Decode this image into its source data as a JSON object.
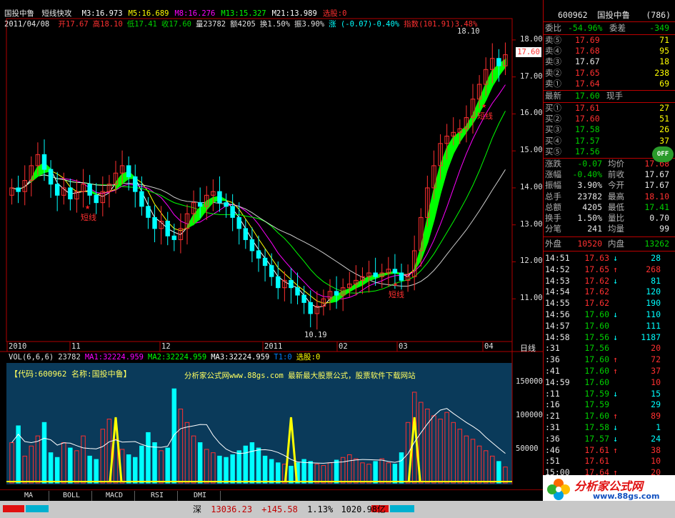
{
  "header": {
    "name": "国投中鲁",
    "indicator": "短线快攻",
    "ma_items": [
      {
        "label": "M3:16.973",
        "color": "#ffffff"
      },
      {
        "label": "M5:16.689",
        "color": "#ffff00"
      },
      {
        "label": "M8:16.276",
        "color": "#ff00ff"
      },
      {
        "label": "M13:15.327",
        "color": "#00ff00"
      },
      {
        "label": "M21:13.989",
        "color": "#ffffff"
      },
      {
        "label": "选股:0",
        "color": "#ff3030"
      }
    ],
    "date": "2011/04/08",
    "quote_items": [
      {
        "label": "开17.67",
        "color": "#ff3030"
      },
      {
        "label": "高18.10",
        "color": "#ff3030"
      },
      {
        "label": "低17.41",
        "color": "#00d000"
      },
      {
        "label": "收17.60",
        "color": "#00d000"
      },
      {
        "label": "量23782",
        "color": "#e0e0e0"
      },
      {
        "label": "额4205",
        "color": "#e0e0e0"
      },
      {
        "label": "换1.50%",
        "color": "#e0e0e0"
      },
      {
        "label": "振3.90%",
        "color": "#e0e0e0"
      },
      {
        "label": "涨 (-0.07)-0.40%",
        "color": "#00ffff"
      },
      {
        "label": "指数(101.91)3.48%",
        "color": "#ff3030"
      }
    ]
  },
  "price_axis": {
    "labels": [
      "18.00",
      "17.00",
      "16.00",
      "15.00",
      "14.00",
      "13.00",
      "12.00",
      "11.00"
    ],
    "current_price": "17.60",
    "high_label": "18.10",
    "low_label": "10.19"
  },
  "annotations": {
    "short_line": "短线"
  },
  "time_axis": {
    "labels": [
      "2010",
      "11",
      "12",
      "2011",
      "02",
      "03",
      "04"
    ],
    "period": "日线"
  },
  "volume": {
    "header_items": [
      {
        "label": "VOL(6,6,6)",
        "color": "#e0e0e0"
      },
      {
        "label": "23782",
        "color": "#e0e0e0"
      },
      {
        "label": "MA1:32224.959",
        "color": "#ff00ff"
      },
      {
        "label": "MA2:32224.959",
        "color": "#00ff00"
      },
      {
        "label": "MA3:32224.959",
        "color": "#ffffff"
      },
      {
        "label": "T1:0",
        "color": "#0080ff"
      },
      {
        "label": "选股:0",
        "color": "#ffff00"
      }
    ],
    "code_label": "【代码:600962 名称:国投中鲁】",
    "promo": "分析家公式网www.88gs.com 最新最大股票公式，股票软件下载网站",
    "axis_labels": [
      "150000",
      "100000",
      "50000"
    ]
  },
  "bottom_tabs": [
    "MA",
    "BOLL",
    "MACD",
    "RSI",
    "DMI"
  ],
  "right_panel": {
    "code": "600962",
    "name": "国投中鲁",
    "number": "(786)",
    "weibi_label": "委比",
    "weibi_value": "-54.96%",
    "weicha_label": "委差",
    "weicha_value": "-349",
    "asks": [
      {
        "label": "卖⑤",
        "price": "17.69",
        "vol": "71"
      },
      {
        "label": "卖④",
        "price": "17.68",
        "vol": "95"
      },
      {
        "label": "卖③",
        "price": "17.67",
        "vol": "18"
      },
      {
        "label": "卖②",
        "price": "17.65",
        "vol": "238"
      },
      {
        "label": "卖①",
        "price": "17.64",
        "vol": "69"
      }
    ],
    "latest_label": "最新",
    "latest_value": "17.60",
    "hand_label": "现手",
    "bids": [
      {
        "label": "买①",
        "price": "17.61",
        "vol": "27"
      },
      {
        "label": "买②",
        "price": "17.60",
        "vol": "51"
      },
      {
        "label": "买③",
        "price": "17.58",
        "vol": "26"
      },
      {
        "label": "买④",
        "price": "17.57",
        "vol": "37"
      },
      {
        "label": "买⑤",
        "price": "17.56",
        "vol": "1"
      }
    ],
    "stats": [
      {
        "l1": "涨跌",
        "v1": "-0.07",
        "c1": "green",
        "l2": "均价",
        "v2": "17.68",
        "c2": "red"
      },
      {
        "l1": "涨幅",
        "v1": "-0.40%",
        "c1": "green",
        "l2": "前收",
        "v2": "17.67",
        "c2": "white"
      },
      {
        "l1": "振幅",
        "v1": "3.90%",
        "c1": "white",
        "l2": "今开",
        "v2": "17.67",
        "c2": "white"
      },
      {
        "l1": "总手",
        "v1": "23782",
        "c1": "white",
        "l2": "最高",
        "v2": "18.10",
        "c2": "red"
      },
      {
        "l1": "总额",
        "v1": "4205",
        "c1": "white",
        "l2": "最低",
        "v2": "17.41",
        "c2": "green"
      },
      {
        "l1": "换手",
        "v1": "1.50%",
        "c1": "white",
        "l2": "量比",
        "v2": "0.70",
        "c2": "white"
      },
      {
        "l1": "分笔",
        "v1": "241",
        "c1": "white",
        "l2": "均量",
        "v2": "99",
        "c2": "white"
      }
    ],
    "outer_label": "外盘",
    "outer_value": "10520",
    "inner_label": "内盘",
    "inner_value": "13262",
    "ticks": [
      {
        "t": "14:51",
        "p": "17.63",
        "pc": "red",
        "a": "↓",
        "ac": "cyan",
        "v": "28",
        "vc": "cyan"
      },
      {
        "t": "14:52",
        "p": "17.65",
        "pc": "red",
        "a": "↑",
        "ac": "red",
        "v": "268",
        "vc": "red"
      },
      {
        "t": "14:53",
        "p": "17.62",
        "pc": "red",
        "a": "↓",
        "ac": "cyan",
        "v": "81",
        "vc": "cyan"
      },
      {
        "t": "14:54",
        "p": "17.62",
        "pc": "red",
        "a": "",
        "ac": "cyan",
        "v": "120",
        "vc": "cyan"
      },
      {
        "t": "14:55",
        "p": "17.62",
        "pc": "red",
        "a": "",
        "ac": "cyan",
        "v": "190",
        "vc": "cyan"
      },
      {
        "t": "14:56",
        "p": "17.60",
        "pc": "green",
        "a": "↓",
        "ac": "cyan",
        "v": "110",
        "vc": "cyan"
      },
      {
        "t": "14:57",
        "p": "17.60",
        "pc": "green",
        "a": "",
        "ac": "cyan",
        "v": "111",
        "vc": "cyan"
      },
      {
        "t": "14:58",
        "p": "17.56",
        "pc": "green",
        "a": "↓",
        "ac": "cyan",
        "v": "1187",
        "vc": "cyan"
      },
      {
        "t": ":31",
        "p": "17.56",
        "pc": "green",
        "a": "",
        "ac": "red",
        "v": "20",
        "vc": "red"
      },
      {
        "t": ":36",
        "p": "17.60",
        "pc": "green",
        "a": "↑",
        "ac": "red",
        "v": "72",
        "vc": "red"
      },
      {
        "t": ":41",
        "p": "17.60",
        "pc": "green",
        "a": "↑",
        "ac": "red",
        "v": "37",
        "vc": "red"
      },
      {
        "t": "14:59",
        "p": "17.60",
        "pc": "green",
        "a": "",
        "ac": "red",
        "v": "10",
        "vc": "red"
      },
      {
        "t": ":11",
        "p": "17.59",
        "pc": "green",
        "a": "↓",
        "ac": "cyan",
        "v": "15",
        "vc": "cyan"
      },
      {
        "t": ":16",
        "p": "17.59",
        "pc": "green",
        "a": "",
        "ac": "cyan",
        "v": "29",
        "vc": "cyan"
      },
      {
        "t": ":21",
        "p": "17.60",
        "pc": "green",
        "a": "↑",
        "ac": "red",
        "v": "89",
        "vc": "red"
      },
      {
        "t": ":31",
        "p": "17.58",
        "pc": "green",
        "a": "↓",
        "ac": "cyan",
        "v": "1",
        "vc": "cyan"
      },
      {
        "t": ":36",
        "p": "17.57",
        "pc": "green",
        "a": "↓",
        "ac": "cyan",
        "v": "24",
        "vc": "cyan"
      },
      {
        "t": ":46",
        "p": "17.61",
        "pc": "red",
        "a": "↑",
        "ac": "red",
        "v": "38",
        "vc": "red"
      },
      {
        "t": ":51",
        "p": "17.61",
        "pc": "red",
        "a": "",
        "ac": "red",
        "v": "10",
        "vc": "red"
      },
      {
        "t": "15:00",
        "p": "17.64",
        "pc": "red",
        "a": "↑",
        "ac": "red",
        "v": "20",
        "vc": "red"
      }
    ],
    "toggle": "OFF"
  },
  "status_bar": {
    "market": "深",
    "index": "13036.23",
    "change": "+145.58",
    "pct": "1.13%",
    "amount": "1020.98亿"
  },
  "logo": {
    "text": "分析家公式网",
    "url": "www.88gs.com"
  },
  "colors": {
    "up": "#ff3030",
    "down": "#00ffff",
    "ribbon": "#00ff00",
    "volume_bg": "#0a3a5a",
    "axis": "#b00000"
  },
  "chart_data": {
    "type": "candlestick",
    "ylim": [
      10.0,
      18.5
    ],
    "months": [
      "2010-10",
      "2010-11",
      "2010-12",
      "2011-01",
      "2011-02",
      "2011-03",
      "2011-04"
    ],
    "close": [
      14.0,
      13.9,
      14.2,
      14.6,
      14.9,
      14.5,
      14.1,
      13.8,
      14.0,
      13.7,
      13.9,
      14.1,
      13.8,
      13.6,
      13.9,
      14.1,
      14.4,
      14.6,
      14.3,
      13.9,
      13.5,
      13.2,
      12.9,
      13.1,
      12.7,
      12.6,
      12.9,
      13.3,
      13.6,
      13.5,
      13.8,
      13.9,
      13.6,
      13.5,
      13.2,
      12.9,
      12.6,
      12.3,
      12.1,
      11.9,
      11.6,
      11.3,
      11.5,
      11.3,
      11.1,
      10.9,
      10.6,
      10.8,
      11.0,
      11.2,
      11.1,
      11.3,
      11.4,
      11.5,
      11.6,
      11.7,
      11.6,
      11.7,
      11.8,
      11.7,
      11.5,
      11.6,
      12.3,
      13.2,
      14.0,
      14.6,
      15.2,
      15.4,
      15.5,
      15.6,
      15.9,
      16.4,
      16.8,
      17.2,
      17.5,
      17.3,
      17.6
    ],
    "volume": [
      60000,
      85000,
      40000,
      55000,
      70000,
      90000,
      45000,
      38000,
      60000,
      52000,
      48000,
      70000,
      40000,
      35000,
      80000,
      95000,
      65000,
      50000,
      42000,
      38000,
      55000,
      75000,
      60000,
      48000,
      52000,
      140000,
      110000,
      90000,
      70000,
      60000,
      50000,
      45000,
      40000,
      38000,
      42000,
      48000,
      55000,
      60000,
      52000,
      40000,
      35000,
      30000,
      28000,
      25000,
      30000,
      35000,
      32000,
      28000,
      26000,
      30000,
      34000,
      38000,
      42000,
      36000,
      30000,
      28000,
      32000,
      36000,
      30000,
      28000,
      45000,
      90000,
      135000,
      120000,
      110000,
      100000,
      95000,
      105000,
      90000,
      80000,
      70000,
      65000,
      55000,
      48000,
      40000,
      32000,
      23782
    ]
  }
}
